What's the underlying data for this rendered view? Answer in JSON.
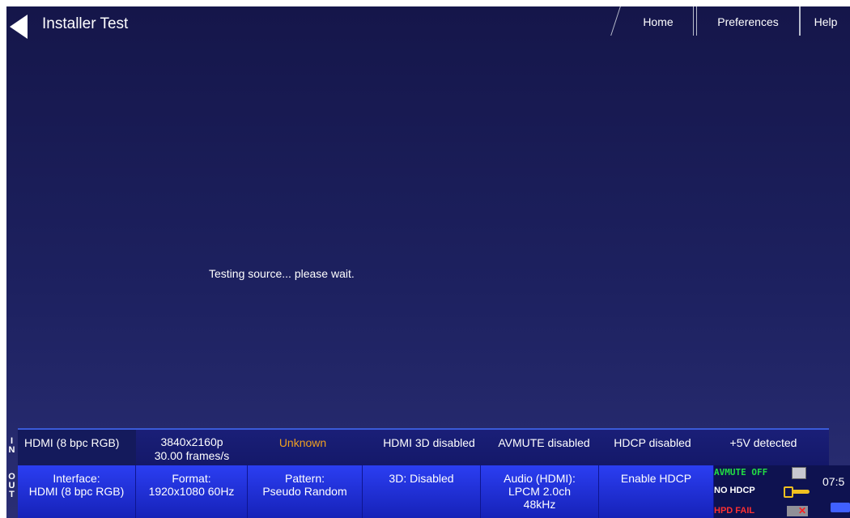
{
  "header": {
    "title": "Installer Test",
    "tabs": {
      "home": "Home",
      "preferences": "Preferences",
      "help": "Help"
    }
  },
  "main": {
    "message": "Testing source... please wait."
  },
  "input_row": {
    "label": "IN",
    "interface": "HDMI (8 bpc RGB)",
    "resolution": "3840x2160p",
    "frame_rate": "30.00 frames/s",
    "pattern": "Unknown",
    "hdmi_3d": "HDMI 3D disabled",
    "avmute": "AVMUTE disabled",
    "hdcp": "HDCP disabled",
    "power": "+5V detected"
  },
  "output_row": {
    "label": "OUT",
    "interface_label": "Interface:",
    "interface_value": "HDMI (8 bpc RGB)",
    "format_label": "Format:",
    "format_value": "1920x1080 60Hz",
    "pattern_label": "Pattern:",
    "pattern_value": "Pseudo Random",
    "three_d": "3D: Disabled",
    "audio_label": "Audio (HDMI):",
    "audio_line2": "LPCM 2.0ch",
    "audio_line3": "48kHz",
    "hdcp_button": "Enable HDCP"
  },
  "status": {
    "avmute": "AVMUTE OFF",
    "hdcp": "NO HDCP",
    "hpd": "HPD FAIL",
    "clock": "07:5"
  },
  "colors": {
    "accent_orange": "#f0a020",
    "status_green": "#22dd44",
    "status_red": "#ff3030"
  }
}
